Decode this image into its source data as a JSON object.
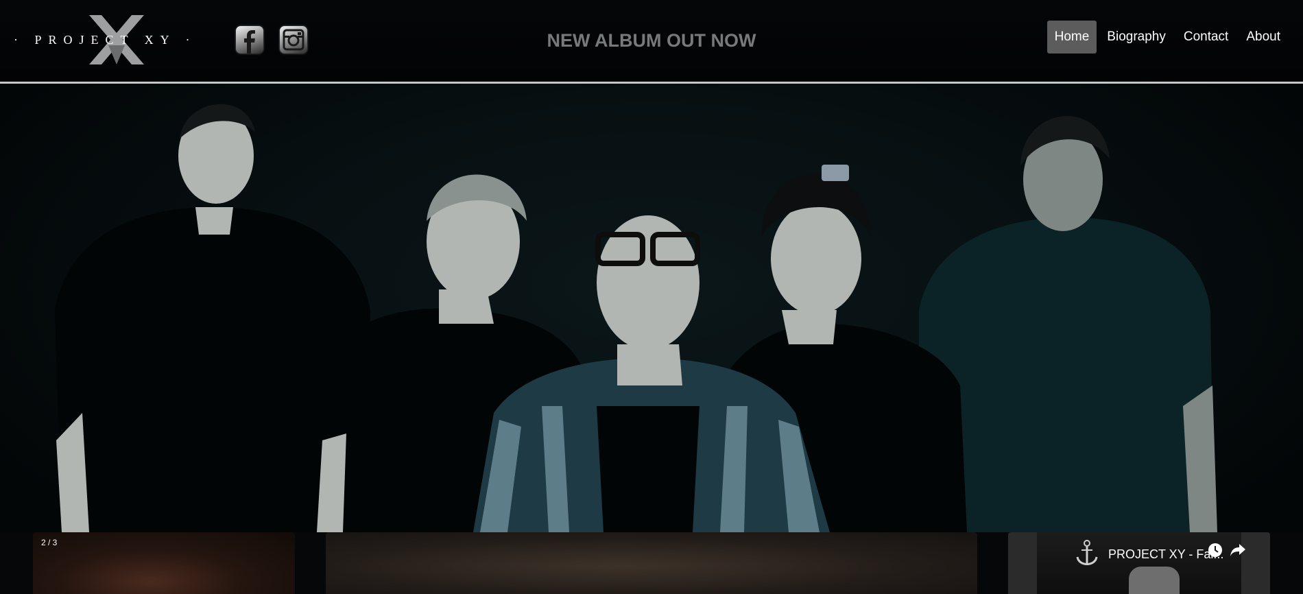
{
  "header": {
    "brand": "· PROJECT XY ·",
    "announcement": "NEW ALBUM OUT NOW",
    "social": [
      {
        "name": "facebook-icon"
      },
      {
        "name": "instagram-icon"
      }
    ],
    "nav": [
      {
        "label": "Home",
        "active": true
      },
      {
        "label": "Biography",
        "active": false
      },
      {
        "label": "Contact",
        "active": false
      },
      {
        "label": "About",
        "active": false
      }
    ]
  },
  "gallery": {
    "counter": "2 / 3"
  },
  "video": {
    "title": "PROJECT XY - Fal..."
  },
  "colors": {
    "background": "#050708",
    "nav_active": "#5c5c5c",
    "announcement": "#777a7c",
    "header_rule": "#c7c7c7"
  }
}
